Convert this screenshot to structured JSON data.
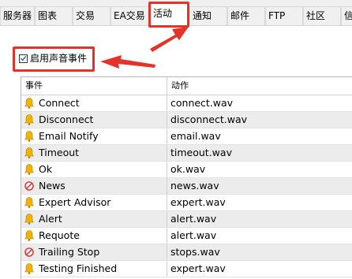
{
  "tabs": [
    {
      "label": "服务器",
      "active": false
    },
    {
      "label": "图表",
      "active": false
    },
    {
      "label": "交易",
      "active": false
    },
    {
      "label": "EA交易",
      "active": false
    },
    {
      "label": "活动",
      "active": true
    },
    {
      "label": "通知",
      "active": false
    },
    {
      "label": "邮件",
      "active": false
    },
    {
      "label": "FTP",
      "active": false
    },
    {
      "label": "社区",
      "active": false
    },
    {
      "label": "信",
      "active": false
    }
  ],
  "enable_sound": {
    "label": "启用声音事件",
    "checked": true
  },
  "columns": {
    "event": "事件",
    "action": "动作"
  },
  "events": [
    {
      "name": "Connect",
      "action": "connect.wav",
      "icon": "bell-icon"
    },
    {
      "name": "Disconnect",
      "action": "disconnect.wav",
      "icon": "bell-icon"
    },
    {
      "name": "Email Notify",
      "action": "email.wav",
      "icon": "bell-icon"
    },
    {
      "name": "Timeout",
      "action": "timeout.wav",
      "icon": "bell-icon"
    },
    {
      "name": "Ok",
      "action": "ok.wav",
      "icon": "bell-icon"
    },
    {
      "name": "News",
      "action": "news.wav",
      "icon": "disabled-icon"
    },
    {
      "name": "Expert Advisor",
      "action": "expert.wav",
      "icon": "bell-icon"
    },
    {
      "name": "Alert",
      "action": "alert.wav",
      "icon": "bell-icon"
    },
    {
      "name": "Requote",
      "action": "alert.wav",
      "icon": "bell-icon"
    },
    {
      "name": "Trailing Stop",
      "action": "stops.wav",
      "icon": "disabled-icon"
    },
    {
      "name": "Testing Finished",
      "action": "expert.wav",
      "icon": "bell-icon"
    }
  ],
  "colors": {
    "highlight": "#e6332a",
    "bell": "#f0b400",
    "disabled": "#e03a3a",
    "row_alt": "#ececec",
    "checkbox_mark": "#2a64c8"
  }
}
